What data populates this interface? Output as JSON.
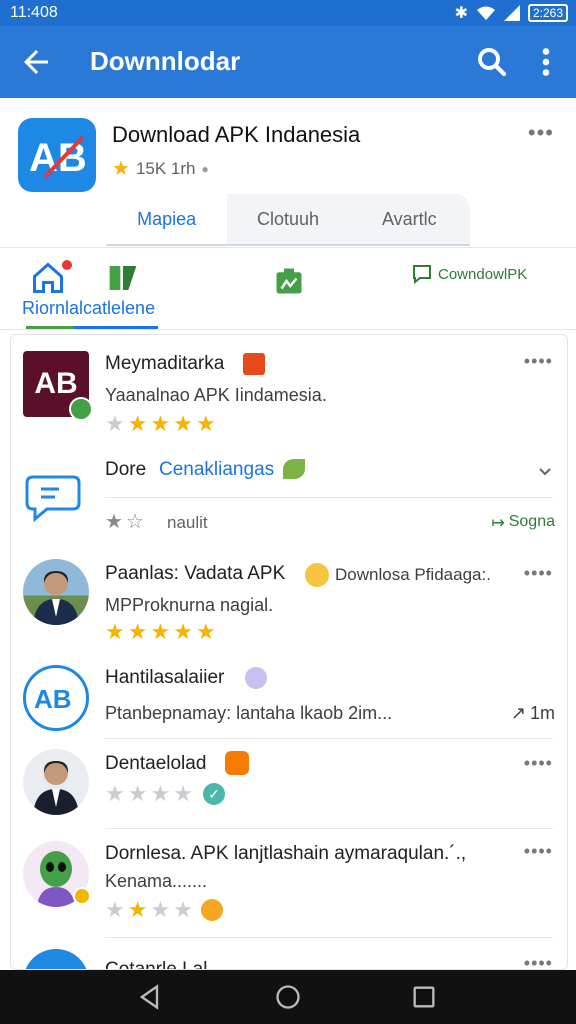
{
  "status": {
    "time": "11:408",
    "battery": "2:263"
  },
  "appbar": {
    "title": "Downnlodar"
  },
  "app": {
    "title": "Download APK Indanesia",
    "rating_text": "15K 1rh",
    "more": "•••"
  },
  "tabs": [
    {
      "label": "Mapiea"
    },
    {
      "label": "Clotuuh"
    },
    {
      "label": "Avartlc"
    }
  ],
  "filters": {
    "label": "Riornlalcatlelene",
    "download_label": "CowndowlPK"
  },
  "list": [
    {
      "title": "Meymaditarka",
      "subtitle": "Yaanalnao APK Iindamesia.",
      "rating": 4,
      "more": "••••"
    },
    {
      "title": "Dore",
      "title_link": "Cenakliangas",
      "meta": "naulit",
      "action": "Sogna"
    },
    {
      "title": "Paanlas: Vadata APK",
      "title_extra": "Downlosa Pfidaaga:.",
      "subtitle": "MPProknurna nagial.",
      "rating": 5,
      "more": "••••"
    },
    {
      "title": "Hantilasalaiier",
      "subtitle": "Ptanbepnamay: lantaha lkaob 2im...",
      "time": "1m"
    },
    {
      "title": "Dentaelolad",
      "rating": 0,
      "more": "••••"
    },
    {
      "title": "Dornlesa. APK lanjtlashain aymaraqulan.´.,",
      "subtitle": "Kenama.......",
      "rating": 2,
      "more": "••••"
    },
    {
      "title": "Cotanrle Lal",
      "more": "••••"
    }
  ],
  "colors": {
    "primary": "#2a79d6",
    "accent": "#1a73e8",
    "star": "#f5b400",
    "green": "#2e7d32"
  }
}
